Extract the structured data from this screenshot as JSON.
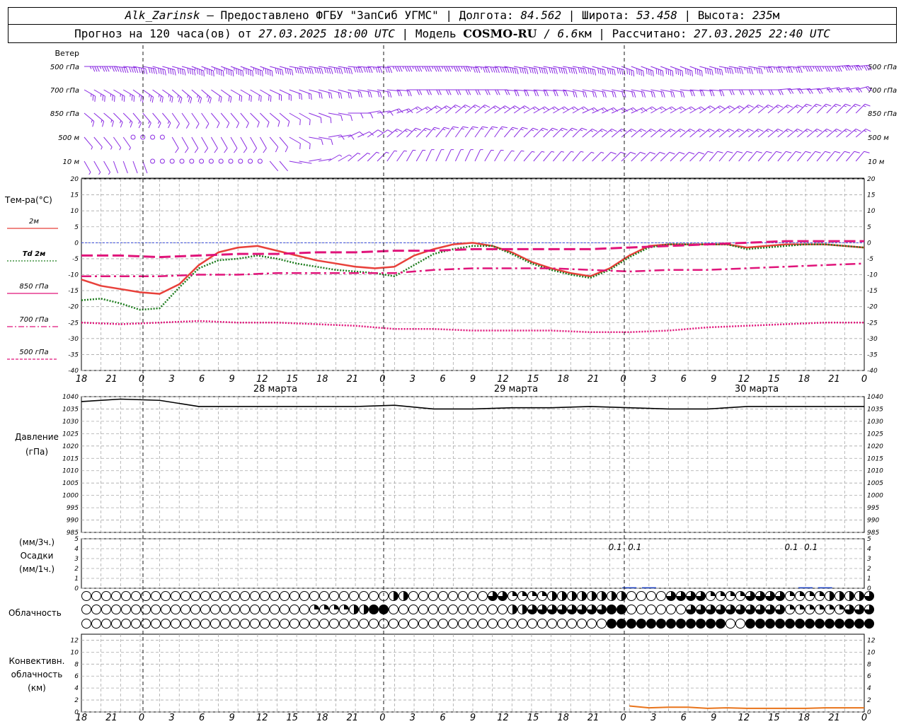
{
  "header": {
    "station": "Alk_Zarinsk",
    "provider": " – Предоставлено ФГБУ \"ЗапСиб УГМС\" | Долгота: ",
    "lon": "84.562",
    "lat_label": " | Широта: ",
    "lat": "53.458",
    "alt_label": " | Высота: ",
    "alt": "235",
    "alt_unit": "м",
    "forecast_label": "Прогноз на 120 часа(ов) от ",
    "init": "27.03.2025 18:00 UTC",
    "model_label": " | Модель ",
    "model": "COSMO-RU",
    "res": " / 6.6",
    "res_unit": "км",
    "calc_label": " | Рассчитано: ",
    "calc": "27.03.2025 22:40 UTC"
  },
  "wind_panel": {
    "title": "Ветер",
    "levels": [
      "500 гПа",
      "700 гПа",
      "850 гПа",
      "500 м",
      "10  м"
    ],
    "color": "#8a2be2"
  },
  "temp_panel": {
    "title": "Тем-ра(°С)",
    "legend": [
      {
        "label": "2м",
        "color": "#e8403a"
      },
      {
        "label": "Td 2м",
        "color": "#1e7d1e"
      },
      {
        "label": "850 гПа",
        "color": "#e0147a"
      },
      {
        "label": "700 гПа",
        "color": "#e0147a"
      },
      {
        "label": "500 гПа",
        "color": "#e0147a"
      }
    ]
  },
  "pressure_panel": {
    "title": "Давление",
    "unit": "(гПа)"
  },
  "precip_panel": {
    "unit_top": "(мм/3ч.)",
    "title": "Осадки",
    "unit_bottom": "(мм/1ч.)",
    "labels": [
      "0.1",
      "0.1",
      "0.1",
      "0.1"
    ]
  },
  "cloud_panel": {
    "title": "Облачность"
  },
  "conv_panel": {
    "title_1": "Конвективн.",
    "title_2": "облачность",
    "unit": "(км)"
  },
  "time_axis": {
    "hour_labels": [
      "18",
      "21",
      "0",
      "3",
      "6",
      "9",
      "12",
      "15",
      "18",
      "21",
      "0",
      "3",
      "6",
      "9",
      "12",
      "15",
      "18",
      "21",
      "0",
      "3",
      "6",
      "9",
      "12",
      "15",
      "18",
      "21",
      "0"
    ],
    "date_labels": [
      "28 марта",
      "29 марта",
      "30 марта"
    ]
  },
  "chart_data": [
    {
      "type": "line",
      "title": "Тем-ра(°С)",
      "x_unit": "hours since 27.03.2025 18:00 UTC",
      "ylim": [
        -40,
        20
      ],
      "y_ticks": [
        20,
        15,
        10,
        5,
        0,
        -5,
        -10,
        -15,
        -20,
        -25,
        -30,
        -35,
        -40
      ],
      "series": [
        {
          "name": "2м",
          "color": "#e8403a",
          "x": [
            0,
            3,
            6,
            9,
            12,
            15,
            18,
            21,
            24,
            27,
            30,
            33,
            36,
            39,
            42,
            45,
            48,
            51,
            54,
            57,
            60,
            63,
            66,
            69,
            72,
            75,
            78,
            81,
            84,
            87,
            90,
            93,
            96,
            99,
            102,
            105,
            108,
            111,
            114,
            117,
            120
          ],
          "values": [
            -11.5,
            -13.5,
            -14.5,
            -15.5,
            -16,
            -13,
            -7,
            -3,
            -1.5,
            -1,
            -2.5,
            -4,
            -5.5,
            -6.5,
            -7.5,
            -8,
            -7.5,
            -4,
            -2,
            -0.5,
            0,
            -1,
            -3,
            -6,
            -8,
            -9.5,
            -10.5,
            -8,
            -4,
            -1,
            -0.5,
            -0.5,
            -0.5,
            -0.5,
            -1.5,
            -1,
            -0.5,
            -0.5,
            -0.5,
            -1,
            -1.5
          ]
        },
        {
          "name": "Td 2м",
          "color": "#1e7d1e",
          "x": [
            0,
            3,
            6,
            9,
            12,
            15,
            18,
            21,
            24,
            27,
            30,
            33,
            36,
            39,
            42,
            45,
            48,
            51,
            54,
            57,
            60,
            63,
            66,
            69,
            72,
            75,
            78,
            81,
            84,
            87,
            90,
            93,
            96,
            99,
            102,
            105,
            108,
            111,
            114,
            117,
            120
          ],
          "values": [
            -18,
            -17.5,
            -19,
            -21,
            -20.5,
            -14,
            -8,
            -5.5,
            -5,
            -4,
            -5,
            -6.5,
            -7.5,
            -8.5,
            -9,
            -9.5,
            -10.5,
            -7,
            -3.5,
            -2,
            -1,
            -1,
            -3.5,
            -6.5,
            -8.5,
            -10,
            -11,
            -8.5,
            -4.5,
            -1.5,
            -0.5,
            -0.5,
            -0.5,
            -0.5,
            -2,
            -1.5,
            -1,
            -0.5,
            -0.5,
            -1,
            -1.5
          ]
        },
        {
          "name": "850 гПа",
          "color": "#e0147a",
          "x": [
            0,
            6,
            12,
            18,
            24,
            30,
            36,
            42,
            48,
            54,
            60,
            66,
            72,
            78,
            84,
            90,
            96,
            102,
            108,
            114,
            120
          ],
          "values": [
            -4,
            -4,
            -4.5,
            -4,
            -3.5,
            -3.5,
            -3,
            -3,
            -2.5,
            -2.5,
            -2,
            -2,
            -2,
            -2,
            -1.5,
            -1,
            -0.5,
            0,
            0.5,
            0.5,
            0.5
          ]
        },
        {
          "name": "700 гПа",
          "color": "#e0147a",
          "x": [
            0,
            6,
            12,
            18,
            24,
            30,
            36,
            42,
            48,
            54,
            60,
            66,
            72,
            78,
            84,
            90,
            96,
            102,
            108,
            114,
            120
          ],
          "values": [
            -10.5,
            -10.5,
            -10.5,
            -10,
            -10,
            -9.5,
            -9.5,
            -9.5,
            -9.5,
            -8.5,
            -8,
            -8,
            -8,
            -8.5,
            -9,
            -8.5,
            -8.5,
            -8,
            -7.5,
            -7,
            -6.5
          ]
        },
        {
          "name": "500 гПа",
          "color": "#e0147a",
          "x": [
            0,
            6,
            12,
            18,
            24,
            30,
            36,
            42,
            48,
            54,
            60,
            66,
            72,
            78,
            84,
            90,
            96,
            102,
            108,
            114,
            120
          ],
          "values": [
            -25,
            -25.5,
            -25,
            -24.5,
            -25,
            -25,
            -25.5,
            -26,
            -27,
            -27,
            -27.5,
            -27.5,
            -27.5,
            -28,
            -28,
            -27.5,
            -26.5,
            -26,
            -25.5,
            -25,
            -25
          ]
        }
      ]
    },
    {
      "type": "line",
      "title": "Давление",
      "ylabel": "(гПа)",
      "ylim": [
        985,
        1040
      ],
      "y_ticks": [
        1040,
        1035,
        1030,
        1025,
        1020,
        1015,
        1010,
        1005,
        1000,
        995,
        990,
        985
      ],
      "series": [
        {
          "name": "Давление",
          "color": "#000000",
          "x": [
            0,
            6,
            12,
            18,
            24,
            30,
            36,
            42,
            48,
            54,
            60,
            66,
            72,
            78,
            84,
            90,
            96,
            102,
            108,
            114,
            120
          ],
          "values": [
            1038,
            1039,
            1038.5,
            1036,
            1036,
            1036,
            1036,
            1036,
            1036.5,
            1035,
            1035,
            1035.5,
            1035.5,
            1036,
            1035.5,
            1035,
            1035,
            1036,
            1036,
            1036,
            1036
          ]
        }
      ]
    },
    {
      "type": "bar",
      "title": "Осадки",
      "ylabel": "(мм/3ч.) (мм/1ч.)",
      "ylim": [
        0,
        5
      ],
      "y_ticks": [
        5,
        4,
        3,
        2,
        1,
        0
      ],
      "series": [
        {
          "name": "Осадки",
          "color": "#1a3fc0",
          "x": [
            84,
            87,
            111,
            114
          ],
          "values": [
            0.1,
            0.1,
            0.1,
            0.1
          ]
        }
      ]
    },
    {
      "type": "table",
      "title": "Облачность",
      "rows_note": "cloud cover eighths per 3 h step, rows: upper, middle, lower",
      "x": [
        0,
        3,
        6,
        9,
        12,
        15,
        18,
        21,
        24,
        27,
        30,
        33,
        36,
        39,
        42,
        45,
        48,
        51,
        54,
        57,
        60,
        63,
        66,
        69,
        72,
        75,
        78,
        81,
        84,
        87,
        90,
        93,
        96,
        99,
        102,
        105,
        108,
        111,
        114,
        117,
        120
      ],
      "upper": [
        0,
        0,
        0,
        0,
        0,
        0,
        0,
        0,
        0,
        0,
        0,
        0,
        0,
        0,
        0,
        0,
        4,
        0,
        0,
        0,
        0,
        6,
        2,
        2,
        4,
        4,
        4,
        4,
        0,
        0,
        6,
        6,
        2,
        2,
        6,
        6,
        2,
        2,
        4,
        4,
        6
      ],
      "middle": [
        0,
        0,
        0,
        0,
        0,
        0,
        0,
        0,
        0,
        0,
        0,
        0,
        2,
        2,
        4,
        8,
        0,
        0,
        0,
        0,
        0,
        0,
        4,
        6,
        6,
        6,
        6,
        8,
        0,
        0,
        0,
        6,
        6,
        6,
        6,
        6,
        2,
        2,
        2,
        6,
        6
      ],
      "lower": [
        0,
        0,
        0,
        0,
        0,
        0,
        0,
        0,
        0,
        0,
        0,
        0,
        0,
        0,
        0,
        0,
        0,
        0,
        0,
        0,
        0,
        0,
        0,
        0,
        0,
        0,
        0,
        8,
        8,
        8,
        8,
        8,
        8,
        0,
        8,
        8,
        8,
        8,
        8,
        8,
        8
      ]
    },
    {
      "type": "line",
      "title": "Конвективн. облачность",
      "ylabel": "(км)",
      "ylim": [
        0,
        13
      ],
      "y_ticks": [
        12,
        10,
        8,
        6,
        4,
        2,
        0
      ],
      "series": [
        {
          "name": "Конвективн. облачность",
          "color": "#e8731a",
          "x": [
            84,
            87,
            90,
            93,
            96,
            99,
            102,
            105,
            108,
            111,
            114,
            117,
            120
          ],
          "values": [
            1,
            0.7,
            0.8,
            0.8,
            0.6,
            0.7,
            0.6,
            0.6,
            0.6,
            0.6,
            0.7,
            0.7,
            0.7
          ]
        }
      ]
    },
    {
      "type": "scatter",
      "title": "Ветер",
      "note": "wind barbs, direction in degrees (meteorological), speed in m/s, per level",
      "levels": [
        "500 гПа",
        "700 гПа",
        "850 гПа",
        "500 м",
        "10  м"
      ],
      "x": [
        0,
        3,
        6,
        9,
        12,
        15,
        18,
        21,
        24,
        27,
        30,
        33,
        36,
        39,
        42,
        45,
        48,
        51,
        54,
        57,
        60,
        63,
        66,
        69,
        72,
        75,
        78,
        81,
        84,
        87,
        90,
        93,
        96,
        99,
        102,
        105,
        108,
        111,
        114,
        117,
        120
      ],
      "direction": [
        [
          270,
          270,
          275,
          280,
          285,
          285,
          290,
          290,
          290,
          290,
          285,
          280,
          280,
          280,
          275,
          275,
          270,
          270,
          270,
          270,
          275,
          275,
          280,
          280,
          280,
          280,
          285,
          285,
          290,
          290,
          290,
          290,
          285,
          280,
          280,
          275,
          275,
          270,
          270,
          265,
          265
        ],
        [
          300,
          300,
          300,
          305,
          305,
          310,
          310,
          305,
          300,
          300,
          295,
          290,
          285,
          285,
          280,
          280,
          275,
          270,
          270,
          270,
          270,
          270,
          275,
          275,
          275,
          280,
          280,
          280,
          280,
          280,
          280,
          275,
          275,
          270,
          270,
          270,
          265,
          265,
          260,
          260,
          255
        ],
        [
          310,
          310,
          315,
          320,
          320,
          325,
          325,
          320,
          320,
          315,
          310,
          300,
          290,
          280,
          270,
          260,
          250,
          240,
          235,
          230,
          230,
          235,
          235,
          240,
          240,
          240,
          245,
          245,
          245,
          240,
          240,
          240,
          235,
          235,
          230,
          230,
          230,
          225,
          225,
          225,
          225
        ],
        [
          320,
          320,
          325,
          330,
          330,
          330,
          330,
          330,
          330,
          330,
          320,
          300,
          280,
          260,
          245,
          235,
          230,
          225,
          220,
          215,
          215,
          215,
          220,
          225,
          225,
          225,
          230,
          230,
          230,
          230,
          230,
          230,
          230,
          230,
          230,
          230,
          230,
          230,
          230,
          230,
          230
        ],
        [
          330,
          330,
          340,
          340,
          0,
          0,
          0,
          0,
          0,
          0,
          320,
          280,
          260,
          240,
          230,
          225,
          215,
          210,
          205,
          205,
          205,
          210,
          215,
          220,
          220,
          220,
          225,
          225,
          225,
          225,
          225,
          225,
          220,
          220,
          220,
          220,
          220,
          220,
          220,
          220,
          220
        ]
      ],
      "speed": [
        [
          15,
          15,
          16,
          17,
          17,
          17,
          18,
          18,
          18,
          18,
          17,
          17,
          16,
          16,
          16,
          15,
          15,
          15,
          15,
          15,
          15,
          16,
          16,
          16,
          16,
          16,
          17,
          17,
          17,
          17,
          17,
          16,
          16,
          16,
          15,
          15,
          15,
          15,
          15,
          15,
          15
        ],
        [
          10,
          10,
          10,
          10,
          10,
          10,
          10,
          9,
          9,
          9,
          8,
          8,
          8,
          8,
          8,
          8,
          8,
          8,
          8,
          8,
          8,
          8,
          8,
          8,
          8,
          8,
          8,
          8,
          8,
          8,
          8,
          8,
          8,
          8,
          8,
          8,
          8,
          8,
          8,
          8,
          8
        ],
        [
          6,
          6,
          6,
          6,
          6,
          5,
          5,
          5,
          5,
          5,
          5,
          5,
          5,
          5,
          5,
          5,
          6,
          6,
          6,
          6,
          6,
          6,
          6,
          6,
          6,
          6,
          6,
          7,
          7,
          7,
          7,
          7,
          7,
          7,
          7,
          7,
          7,
          7,
          7,
          7,
          7
        ],
        [
          3,
          3,
          2,
          0,
          0,
          4,
          5,
          5,
          5,
          5,
          5,
          5,
          5,
          5,
          5,
          5,
          6,
          6,
          6,
          6,
          6,
          6,
          6,
          6,
          6,
          6,
          6,
          7,
          7,
          7,
          7,
          7,
          7,
          7,
          7,
          7,
          7,
          7,
          7,
          7,
          7
        ],
        [
          2,
          2,
          1,
          1,
          0,
          0,
          0,
          0,
          0,
          0,
          1,
          1,
          1,
          2,
          2,
          2,
          3,
          3,
          3,
          3,
          3,
          3,
          3,
          3,
          3,
          3,
          3,
          4,
          4,
          4,
          4,
          4,
          4,
          4,
          4,
          4,
          4,
          4,
          4,
          4,
          4
        ]
      ]
    }
  ]
}
